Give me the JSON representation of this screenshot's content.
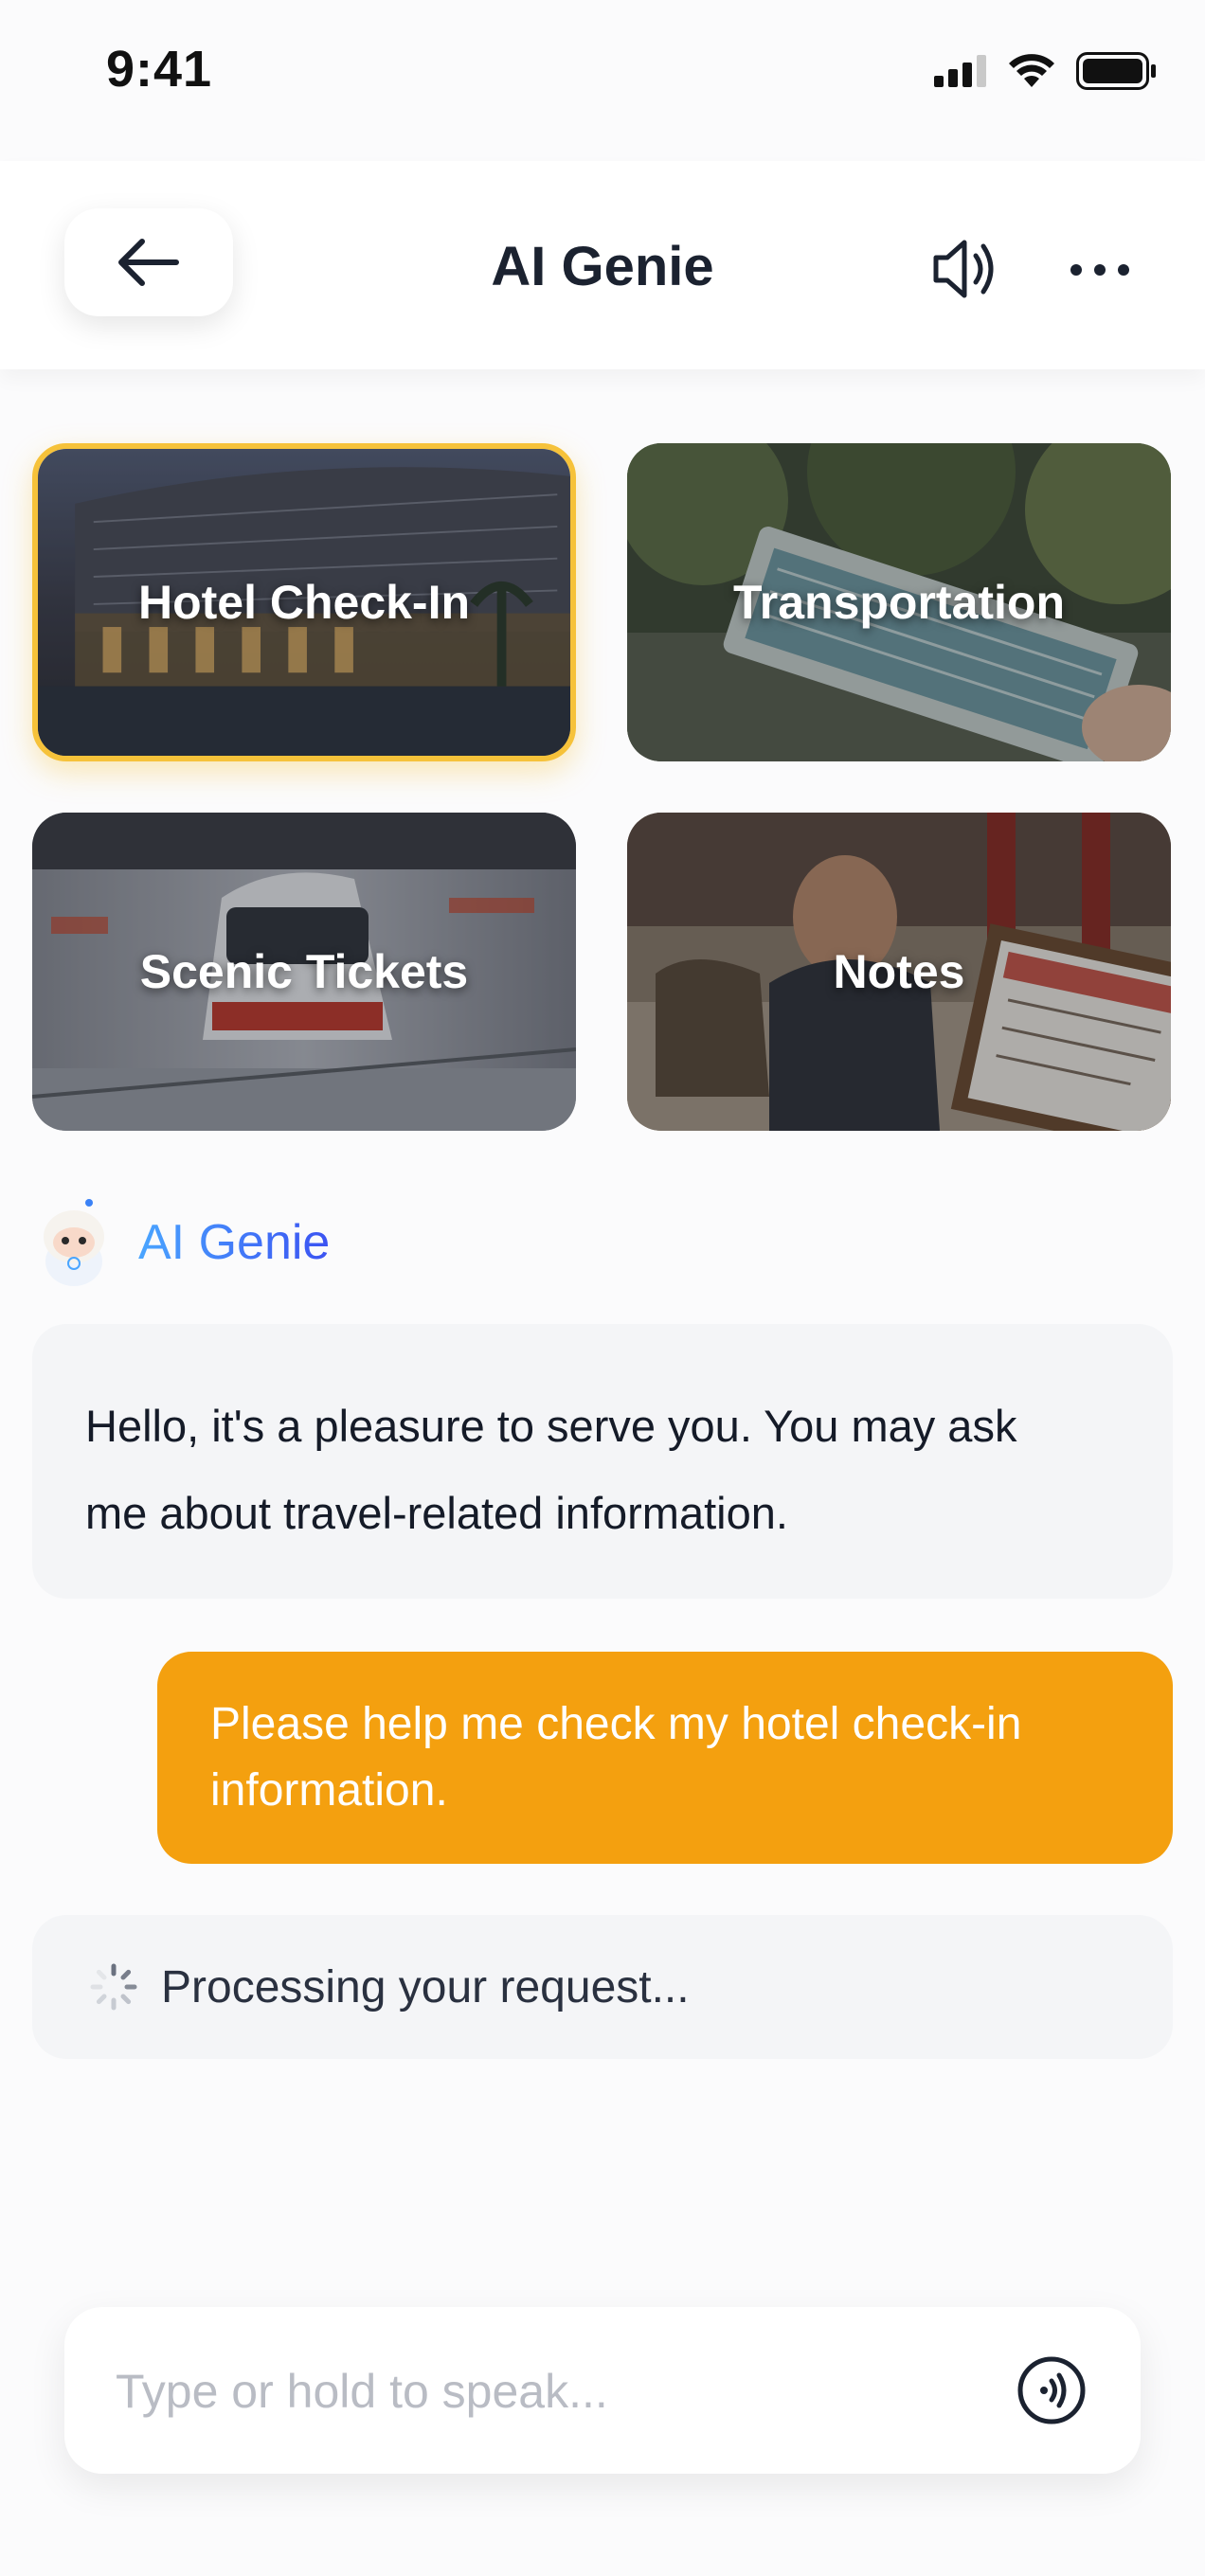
{
  "status_bar": {
    "time": "9:41"
  },
  "header": {
    "title": "AI Genie"
  },
  "tiles": [
    {
      "label": "Hotel Check-In",
      "selected": true
    },
    {
      "label": "Transportation",
      "selected": false
    },
    {
      "label": "Scenic Tickets",
      "selected": false
    },
    {
      "label": "Notes",
      "selected": false
    }
  ],
  "chat": {
    "agent_name": "AI Genie",
    "ai_greeting_line1": "Hello, it's a pleasure to serve you. You may ask",
    "ai_greeting_line2": "me about travel-related information.",
    "user_message_line1": "Please help me check my hotel check-in",
    "user_message_line2": "information.",
    "status_text": "Processing your request..."
  },
  "input": {
    "placeholder": "Type or hold to speak..."
  },
  "colors": {
    "accent": "#f4a00f",
    "selected_border": "#f6c23a",
    "agent_gradient": [
      "#4aa5ff",
      "#3b53f2"
    ]
  },
  "icons": [
    "signal-icon",
    "wifi-icon",
    "battery-icon",
    "back-arrow-icon",
    "speaker-icon",
    "more-icon",
    "genie-avatar-icon",
    "spinner-icon",
    "voice-icon"
  ]
}
